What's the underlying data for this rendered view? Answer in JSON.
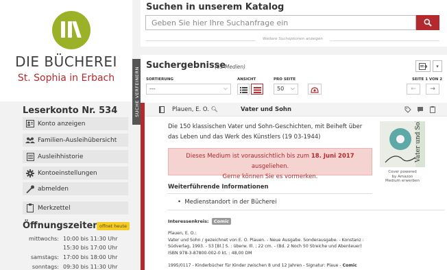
{
  "library": {
    "logo_mark": "III\\",
    "name": "DIE BÜCHEREI",
    "subtitle": "St. Sophia in Erbach"
  },
  "account": {
    "title": "Leserkonto Nr. 534",
    "menu": [
      {
        "label": "Konto anzeigen",
        "icon": "account-card-icon"
      },
      {
        "label": "Familien-Ausleihübersicht",
        "icon": "family-icon"
      },
      {
        "label": "Ausleihhistorie",
        "icon": "history-list-icon"
      },
      {
        "label": "Kontoeinstellungen",
        "icon": "gear-icon"
      },
      {
        "label": "abmelden",
        "icon": "key-icon"
      },
      {
        "label": "Merkzettel",
        "icon": "clipboard-icon"
      }
    ]
  },
  "hours": {
    "title": "Öffnungszeiten",
    "badge": "offnet heute",
    "rows": [
      {
        "day": "mittwochs:",
        "time": "10:00 bis 11:30 Uhr"
      },
      {
        "day": "",
        "time": "15:30 bis 17:00 Uhr"
      },
      {
        "day": "samstags:",
        "time": "17:00 bis 18:00 Uhr"
      },
      {
        "day": "sonntags:",
        "time": "09:30 bis 11:30 Uhr"
      }
    ]
  },
  "side_tab": "SUCHE VERFEINERN",
  "search": {
    "title": "Suchen in unserem Katalog",
    "placeholder": "Geben Sie hier Ihre Suchanfrage ein",
    "more_options": "Weitere Suchoptionen anzeigen"
  },
  "results": {
    "title": "Suchergebnisse",
    "count": "(63 Medien)",
    "sort_label": "SORTIERUNG",
    "sort_value": "---",
    "view_label": "ANSICHT",
    "per_page_label": "PRO SEITE",
    "per_page_value": "50",
    "page_label": "SEITE 1 VON 2",
    "prev": "←",
    "next": "→"
  },
  "record": {
    "author": "Plauen, E. O.",
    "title": "Vater und Sohn",
    "description": "Die 150 klassischen Vater und Sohn-Geschichten, mit Beiheft über das Leben und das Werk des Künstlers (19 03-1944)",
    "alert_prefix": "Dieses Medium ist voraussichtlich bis zum ",
    "alert_date": "18. Juni 2017",
    "alert_suffix": " ausgeliehen.",
    "alert_line2": "Gerne können Sie es vormerken.",
    "more_info_title": "Weiterführende Informationen",
    "link": "Medienstandort in der Bücherei",
    "interest_label": "Interessenkreis:",
    "interest_tag": "Comic",
    "biblio": [
      "Plauen, E. O.:",
      "Vater und Sohn / gezeichnet von E. O. Plauen. - Neue Ausgabe. Sonderausgabe. - Konstanz :",
      "Südverlag, 1993. - 53 [Bl.] S. : überw. Ill. ; 22 cm. - (Bd. 2 Noch 50 Streiche und Abenteuer)",
      "ISBN 978-3-87800-002-0 kt. : 48,00 DM"
    ],
    "biblio_extra": "1995/0117 - Kinderbücher für Kinder zwischen 8 und 12 Jahren - Signatur: Plaue - ",
    "biblio_extra_bold": "Comic",
    "cover_title": "Vater und Sohn",
    "cover_caption_1": "Cover powered",
    "cover_caption_2": "by Amazon",
    "cover_caption_3": "Medium erwerben"
  },
  "colors": {
    "brand_red": "#b3292e",
    "logo_green": "#9bb228",
    "badge_yellow": "#f5cc25"
  }
}
